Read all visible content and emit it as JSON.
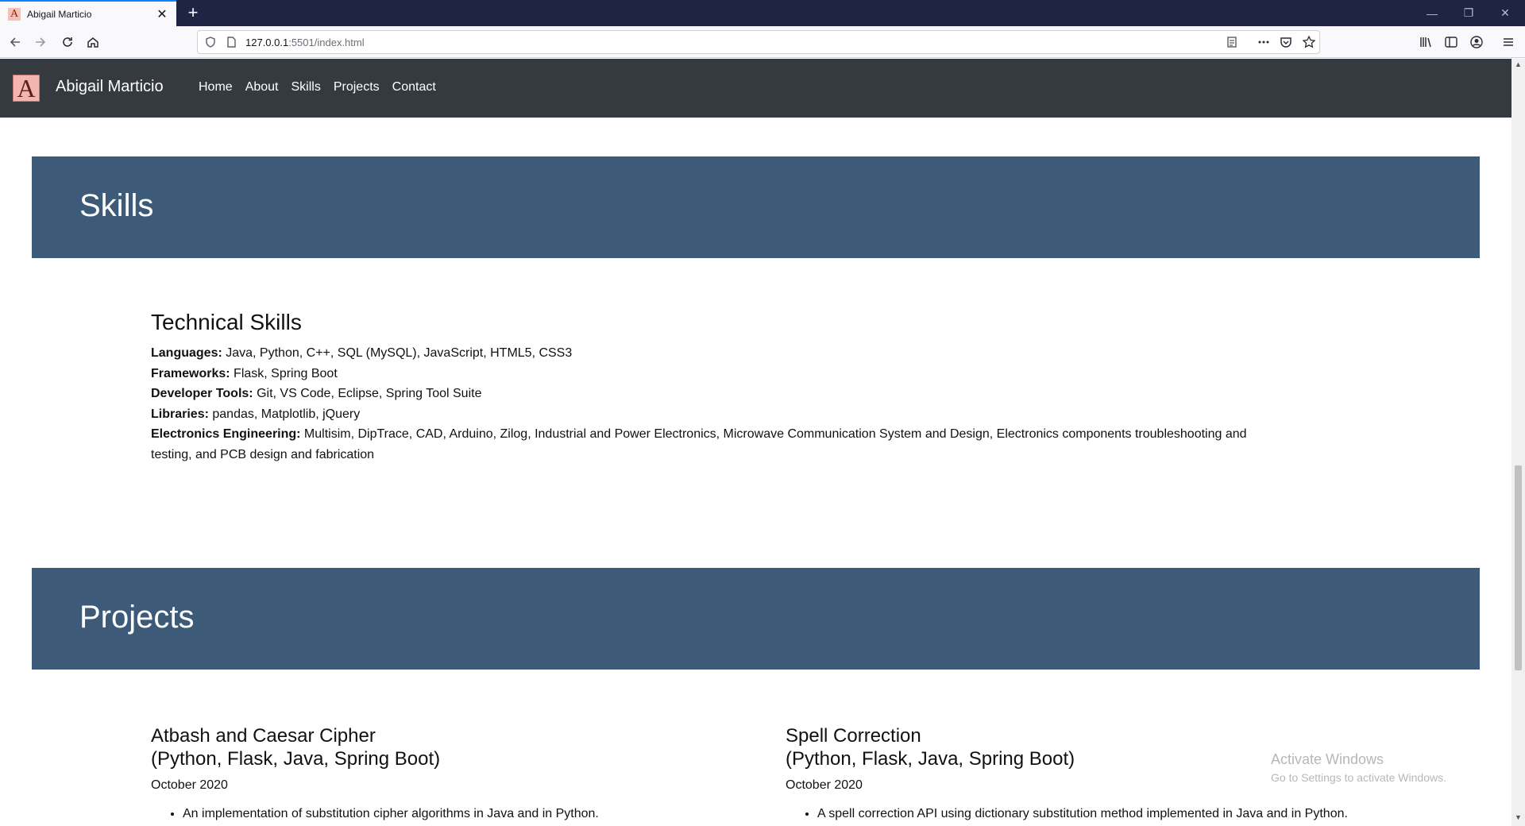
{
  "browser": {
    "tab_title": "Abigail Marticio",
    "favicon_letter": "A",
    "url_host": "127.0.0.1",
    "url_path": ":5501/index.html"
  },
  "site": {
    "logo_letter": "A",
    "brand": "Abigail Marticio",
    "nav": [
      "Home",
      "About",
      "Skills",
      "Projects",
      "Contact"
    ]
  },
  "skills": {
    "banner": "Skills",
    "heading": "Technical Skills",
    "items": [
      {
        "label": "Languages:",
        "value": " Java, Python, C++, SQL (MySQL), JavaScript, HTML5, CSS3"
      },
      {
        "label": "Frameworks:",
        "value": " Flask, Spring Boot"
      },
      {
        "label": "Developer Tools:",
        "value": " Git, VS Code, Eclipse, Spring Tool Suite"
      },
      {
        "label": "Libraries:",
        "value": " pandas, Matplotlib, jQuery"
      },
      {
        "label": "Electronics Engineering:",
        "value": " Multisim, DipTrace, CAD, Arduino, Zilog, Industrial and Power Electronics, Microwave Communication System and Design, Electronics components troubleshooting and testing, and PCB design and fabrication"
      }
    ]
  },
  "projects": {
    "banner": "Projects",
    "items": [
      {
        "title": "Atbash and Caesar Cipher",
        "stack": "(Python, Flask, Java, Spring Boot)",
        "date": "October 2020",
        "bullet": "An implementation of substitution cipher algorithms in Java and in Python."
      },
      {
        "title": "Spell Correction",
        "stack": "(Python, Flask, Java, Spring Boot)",
        "date": "October 2020",
        "bullet": "A spell correction API using dictionary substitution method implemented in Java and in Python."
      }
    ]
  },
  "watermark": {
    "line1": "Activate Windows",
    "line2": "Go to Settings to activate Windows."
  }
}
